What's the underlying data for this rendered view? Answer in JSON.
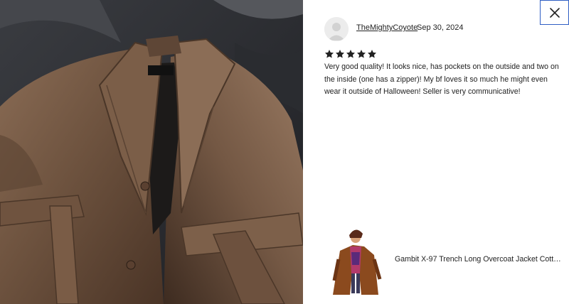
{
  "review": {
    "reviewer_name": "TheMightyCoyote",
    "date": "Sep 30, 2024",
    "rating": 5,
    "rating_max": 5,
    "text": "Very good quality! It looks nice, has pockets on the outside and two on the inside (one has a zipper)! My bf loves it so much he might even wear it outside of Halloween! Seller is very communicative!"
  },
  "photo": {
    "label_text": "Leather Jacket"
  },
  "listing": {
    "title": "Gambit X-97 Trench Long Overcoat Jacket Cotton ..."
  },
  "icons": {
    "close": "close-icon",
    "star": "star-icon",
    "avatar": "avatar-placeholder-icon"
  },
  "colors": {
    "accent_border": "#2f5ec4",
    "text": "#222222"
  }
}
